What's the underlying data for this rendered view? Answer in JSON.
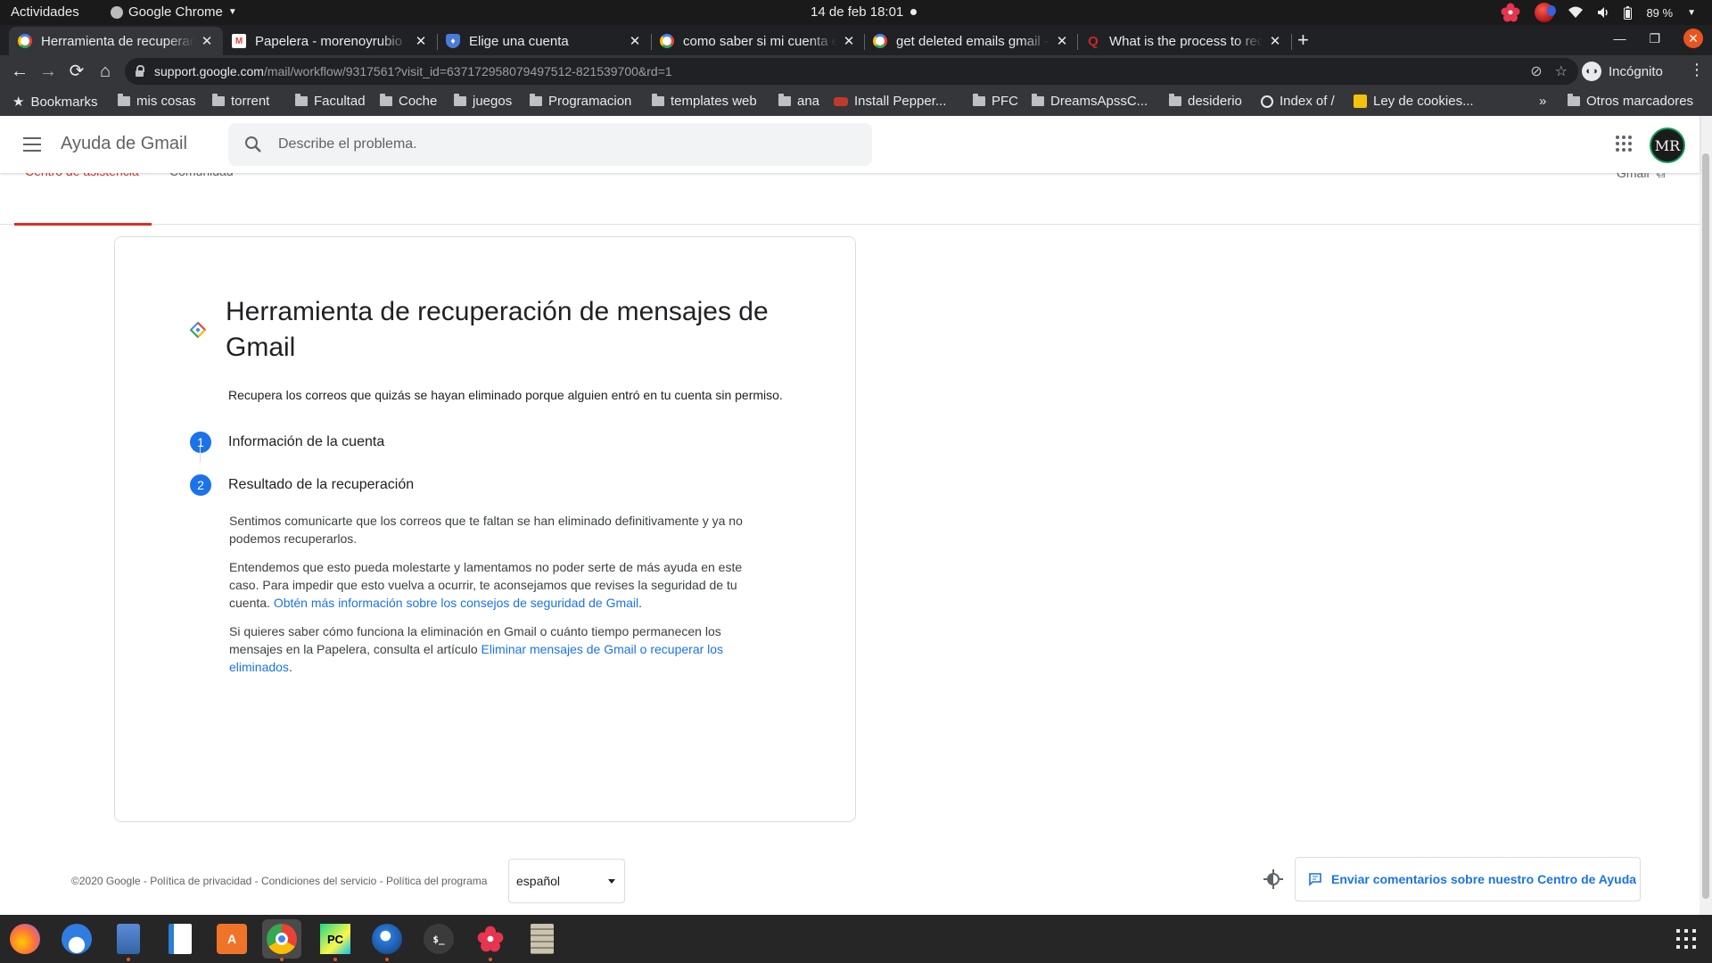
{
  "os": {
    "activities": "Actividades",
    "app_menu": "Google Chrome",
    "clock": "14 de feb  18:01",
    "battery": "89 %"
  },
  "tabs": [
    {
      "title": "Herramienta de recuperación",
      "favicon": "google-g",
      "active": true
    },
    {
      "title": "Papelera - morenoyrubio",
      "favicon": "gmail-m",
      "active": false
    },
    {
      "title": "Elige una cuenta",
      "favicon": "shield",
      "active": false
    },
    {
      "title": "como saber si mi cuenta e",
      "favicon": "google-g",
      "active": false
    },
    {
      "title": "get deleted emails gmail -",
      "favicon": "google-g",
      "active": false
    },
    {
      "title": "What is the process to rec",
      "favicon": "quora-q",
      "active": false
    }
  ],
  "toolbar": {
    "url_host": "support.google.com",
    "url_path": "/mail/workflow/9317561?visit_id=637172958079497512-821539700&rd=1",
    "incognito_label": "Incógnito"
  },
  "bookmarks": {
    "items": [
      {
        "label": "Bookmarks",
        "icon": "star"
      },
      {
        "label": "mis cosas",
        "icon": "folder"
      },
      {
        "label": "torrent",
        "icon": "folder"
      },
      {
        "label": "Facultad",
        "icon": "folder"
      },
      {
        "label": "Coche",
        "icon": "folder"
      },
      {
        "label": "juegos",
        "icon": "folder"
      },
      {
        "label": "Programacion",
        "icon": "folder"
      },
      {
        "label": "templates web",
        "icon": "folder"
      },
      {
        "label": "ana",
        "icon": "folder"
      },
      {
        "label": "Install Pepper...",
        "icon": "red-badge"
      },
      {
        "label": "PFC",
        "icon": "folder"
      },
      {
        "label": "DreamsApssC...",
        "icon": "folder"
      },
      {
        "label": "desiderio",
        "icon": "folder"
      },
      {
        "label": "Index of /",
        "icon": "globe"
      },
      {
        "label": "Ley de cookies...",
        "icon": "cookie"
      }
    ],
    "overflow": "»",
    "other": "Otros marcadores"
  },
  "help": {
    "app_title": "Ayuda de Gmail",
    "search_placeholder": "Describe el problema.",
    "avatar_text": "MR",
    "subnav": {
      "center": "Centro de asistencia",
      "community": "Comunidad",
      "gmail": "Gmail"
    }
  },
  "card": {
    "title": "Herramienta de recuperación de mensajes de Gmail",
    "intro": "Recupera los correos que quizás se hayan eliminado porque alguien entró en tu cuenta sin permiso.",
    "steps": [
      {
        "num": "1",
        "label": "Información de la cuenta"
      },
      {
        "num": "2",
        "label": "Resultado de la recuperación"
      }
    ],
    "para1": "Sentimos comunicarte que los correos que te faltan se han eliminado definitivamente y ya no podemos recuperarlos.",
    "para2_text": "Entendemos que esto pueda molestarte y lamentamos no poder serte de más ayuda en este caso. Para impedir que esto vuelva a ocurrir, te aconsejamos que revises la seguridad de tu cuenta.",
    "para2_link": "Obtén más información sobre los consejos de seguridad de Gmail",
    "para2_tail": ".",
    "para3_text": "Si quieres saber cómo funciona la eliminación en Gmail o cuánto tiempo permanecen los mensajes en la Papelera, consulta el artículo",
    "para3_link": "Eliminar mensajes de Gmail o recuperar los eliminados",
    "para3_tail": "."
  },
  "footer": {
    "legal": "©2020 Google - Política de privacidad - Condiciones del servicio - Política del programa",
    "language": "español",
    "feedback": "Enviar comentarios sobre nuestro Centro de Ayuda"
  },
  "dock": [
    {
      "name": "firefox-icon",
      "running": false
    },
    {
      "name": "thunderbird-icon",
      "running": false
    },
    {
      "name": "files-icon",
      "running": true
    },
    {
      "name": "writer-icon",
      "running": false
    },
    {
      "name": "software-icon",
      "running": false
    },
    {
      "name": "chrome-icon",
      "running": true,
      "active": true
    },
    {
      "name": "pycharm-icon",
      "running": true
    },
    {
      "name": "bird-app-icon",
      "running": true
    },
    {
      "name": "terminal-icon",
      "running": false
    },
    {
      "name": "flower-app-icon",
      "running": true
    },
    {
      "name": "archive-icon",
      "running": false
    }
  ],
  "colors": {
    "accent": "#1a73e8",
    "active_tab_underline": "#d93025",
    "ubuntu_orange": "#e95420"
  }
}
